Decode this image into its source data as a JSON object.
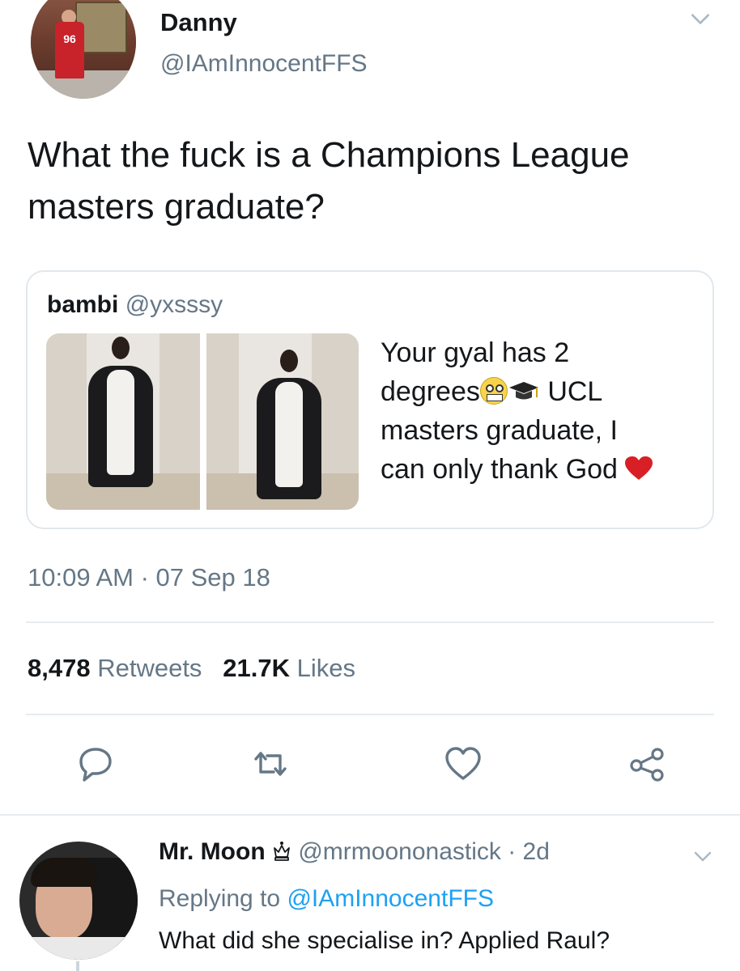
{
  "tweet": {
    "author_name": "Danny",
    "author_handle": "@IAmInnocentFFS",
    "avatar_jersey_number": "96",
    "text": "What the fuck is a Champions League masters graduate?",
    "timestamp": "10:09 AM · 07 Sep 18",
    "retweet_count": "8,478",
    "retweet_label": "Retweets",
    "like_count": "21.7K",
    "like_label": "Likes"
  },
  "quoted_tweet": {
    "author_name": "bambi",
    "author_handle": "@yxsssy",
    "text_line1": "Your gyal has 2",
    "text_line2_start": "degrees",
    "text_line2_end": "UCL",
    "text_line3": "masters graduate, I",
    "text_line4": "can only thank God",
    "emojis": [
      "grimacing-face",
      "graduation-cap",
      "red-heart"
    ]
  },
  "actions": [
    "reply-icon",
    "retweet-icon",
    "like-icon",
    "share-icon"
  ],
  "reply": {
    "author_name": "Mr. Moon",
    "author_badge": "crown-icon",
    "author_handle": "@mrmoononastick",
    "age": "· 2d",
    "replying_prefix": "Replying to",
    "replying_to": "@IAmInnocentFFS",
    "text": "What did she specialise in? Applied Raul?"
  },
  "colors": {
    "text_primary": "#14171a",
    "text_secondary": "#657786",
    "link": "#1da1f2",
    "border": "#e1e8ed",
    "heart": "#d81f26"
  }
}
